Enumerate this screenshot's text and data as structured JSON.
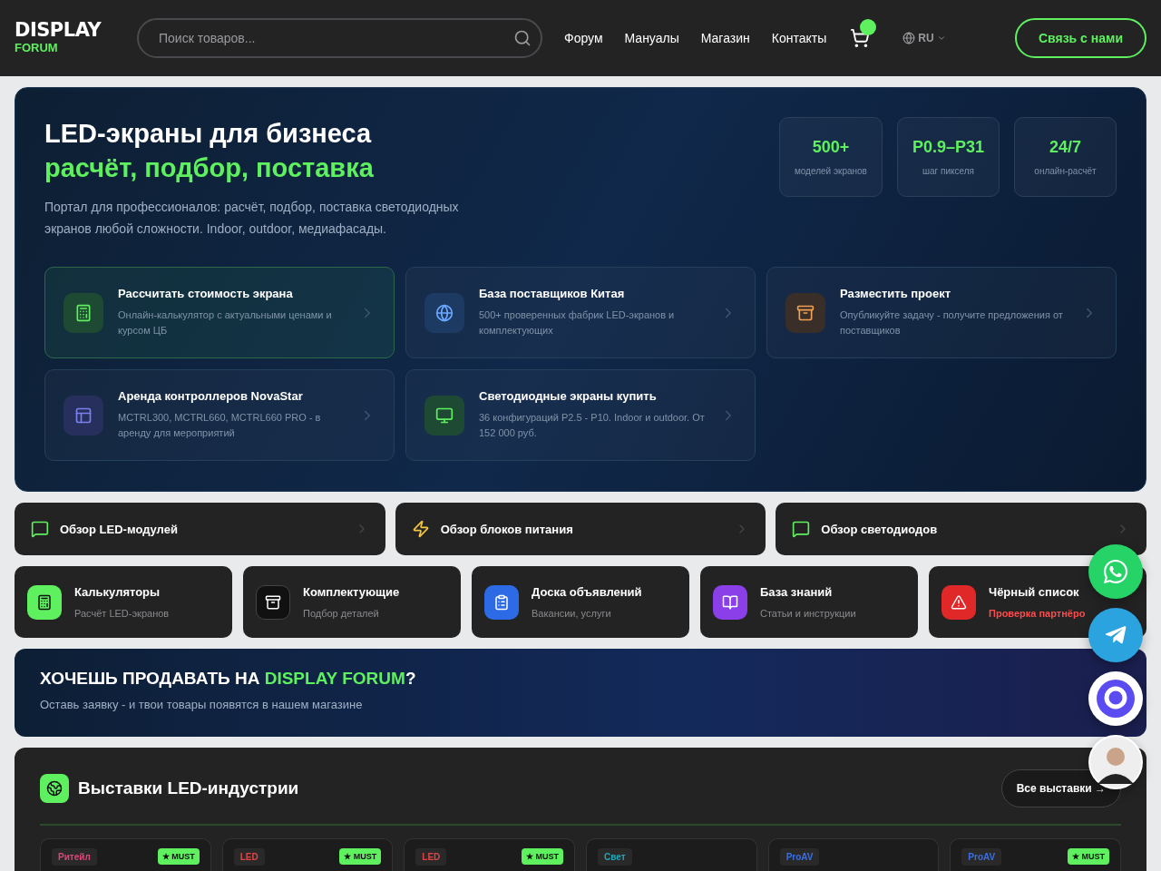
{
  "header": {
    "logo_top": "DISPLAY",
    "logo_bottom": "FORUM",
    "search": {
      "placeholder": "Поиск товаров..."
    },
    "nav": [
      "Форум",
      "Мануалы",
      "Магазин",
      "Контакты"
    ],
    "language": "RU",
    "contact_button": "Связь с нами"
  },
  "hero": {
    "title": "LED-экраны для бизнеса",
    "subtitle": "расчёт, подбор, поставка",
    "description": "Портал для профессионалов: расчёт, подбор, поставка светодиодных экранов любой сложности. Indoor, outdoor, медиафасады.",
    "stats": [
      {
        "value": "500+",
        "label": "моделей экранов"
      },
      {
        "value": "P0.9–P31",
        "label": "шаг пикселя"
      },
      {
        "value": "24/7",
        "label": "онлайн-расчёт"
      }
    ],
    "cards": [
      {
        "title": "Рассчитать стоимость экрана",
        "text": "Онлайн-калькулятор с актуальными ценами и курсом ЦБ",
        "selected": true
      },
      {
        "title": "База поставщиков Китая",
        "text": "500+ проверенных фабрик LED-экранов и комплектующих",
        "selected": false
      },
      {
        "title": "Разместить проект",
        "text": "Опубликуйте задачу - получите предложения от поставщиков",
        "selected": false
      },
      {
        "title": "Аренда контроллеров NovaStar",
        "text": "MCTRL300, MCTRL660, MCTRL660 PRO - в аренду для мероприятий",
        "selected": false
      },
      {
        "title": "Светодиодные экраны купить",
        "text": "36 конфигураций P2.5 - P10. Indoor и outdoor. От 152 000 руб.",
        "selected": false
      }
    ]
  },
  "reviews": [
    "Обзор LED-модулей",
    "Обзор блоков питания",
    "Обзор светодиодов"
  ],
  "tiles": [
    {
      "title": "Калькуляторы",
      "text": "Расчёт LED-экранов",
      "kind": "normal"
    },
    {
      "title": "Комплектующие",
      "text": "Подбор деталей",
      "kind": "normal"
    },
    {
      "title": "Доска объявлений",
      "text": "Вакансии, услуги",
      "kind": "normal"
    },
    {
      "title": "База знаний",
      "text": "Статьи и инструкции",
      "kind": "normal"
    },
    {
      "title": "Чёрный список",
      "text": "Проверка партнёро",
      "kind": "danger"
    }
  ],
  "banner": {
    "title_start": "ХОЧЕШЬ ПРОДАВАТЬ НА ",
    "title_highlight": "DISPLAY FORUM",
    "title_end": "?",
    "text": "Оставь заявку - и твои товары появятся в нашем магазине"
  },
  "exhibitions": {
    "title": "Выставки LED-индустрии",
    "all_button": "Все выставки →",
    "cards": [
      {
        "tag": "Ритейл",
        "color": "#e0457b",
        "must": "★ MUST"
      },
      {
        "tag": "LED",
        "color": "#e04545",
        "must": "★ MUST"
      },
      {
        "tag": "LED",
        "color": "#e04545",
        "must": "★ MUST"
      },
      {
        "tag": "Свет",
        "color": "#1fa8b8"
      },
      {
        "tag": "ProAV",
        "color": "#3b6fe0"
      },
      {
        "tag": "ProAV",
        "color": "#3b6fe0",
        "must": "★ MUST"
      }
    ]
  }
}
